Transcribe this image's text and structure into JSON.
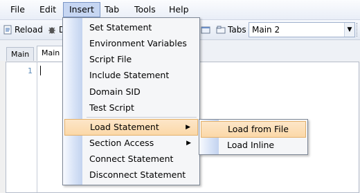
{
  "menubar": {
    "items": [
      "File",
      "Edit",
      "Insert",
      "Tab",
      "Tools",
      "Help"
    ],
    "active_index": 2
  },
  "toolbar": {
    "reload_label": "Reload",
    "debug_label": "D",
    "tabs_label": "Tabs",
    "tab_selector_value": "Main 2"
  },
  "tabs": [
    "Main",
    "Main 2"
  ],
  "editor": {
    "line_numbers": [
      "1"
    ],
    "content": ""
  },
  "insert_menu": {
    "items": [
      {
        "label": "Set Statement"
      },
      {
        "label": "Environment Variables"
      },
      {
        "label": "Script File"
      },
      {
        "label": "Include Statement"
      },
      {
        "label": "Domain SID"
      },
      {
        "label": "Test Script"
      },
      {
        "label": "Load Statement",
        "submenu": true,
        "highlighted": true
      },
      {
        "label": "Section Access",
        "submenu": true
      },
      {
        "label": "Connect Statement"
      },
      {
        "label": "Disconnect Statement"
      }
    ]
  },
  "load_submenu": {
    "items": [
      {
        "label": "Load from File",
        "highlighted": true
      },
      {
        "label": "Load Inline"
      }
    ]
  },
  "colors": {
    "menu_highlight": "#fbd8a8",
    "menu_highlight_border": "#e3b06b",
    "active_menubar": "#c6d6f2",
    "line_number": "#5a8ab8"
  }
}
